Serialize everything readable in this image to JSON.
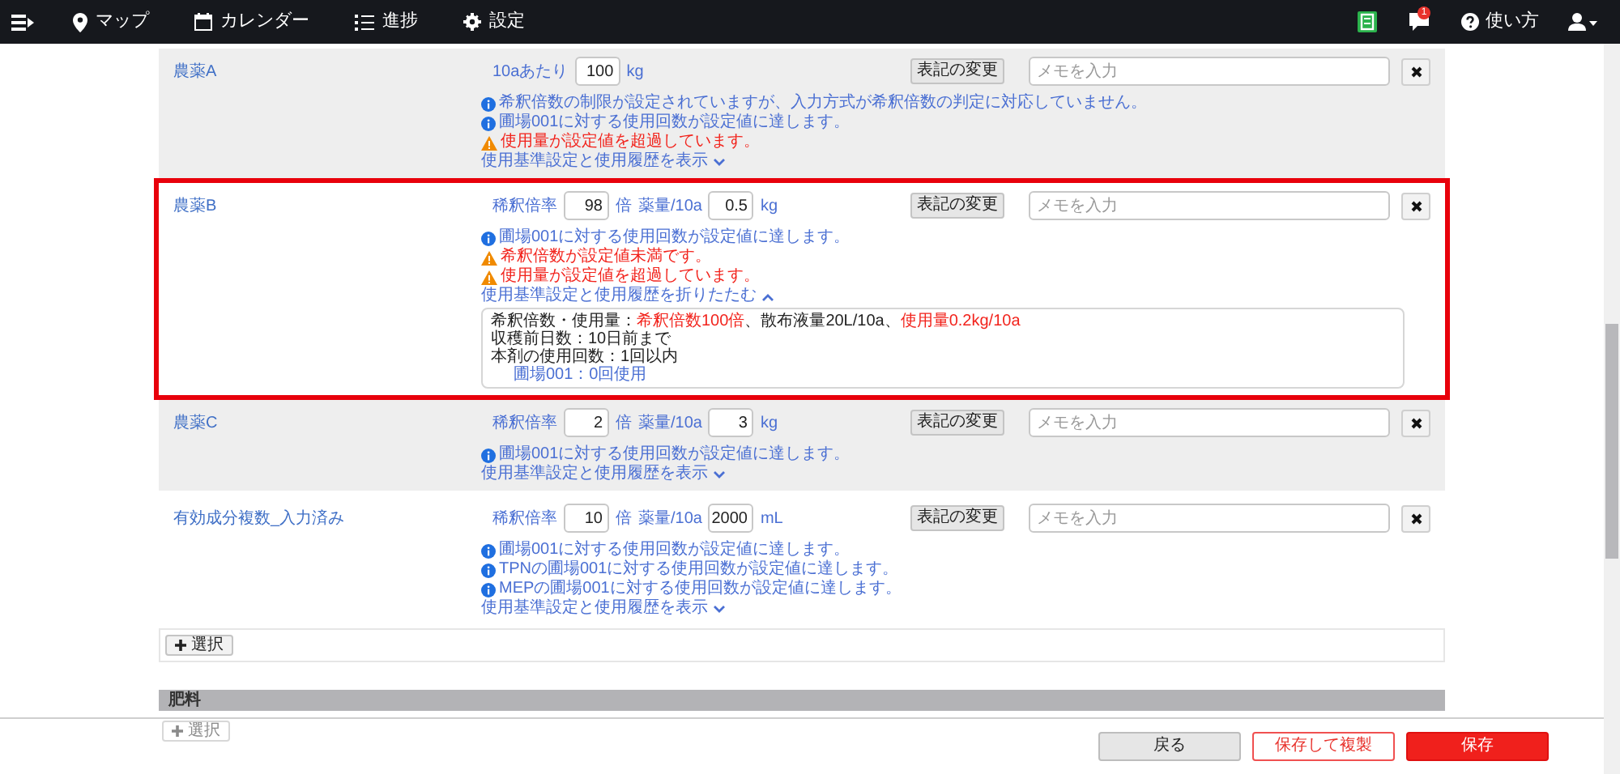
{
  "nav": {
    "items": [
      {
        "label": "マップ"
      },
      {
        "label": "カレンダー"
      },
      {
        "label": "進捗"
      },
      {
        "label": "設定"
      }
    ],
    "notification_count": "1",
    "help": "使い方"
  },
  "rows": [
    {
      "name": "農薬A",
      "highlighted": false,
      "inputs": [
        {
          "label": "10aあたり",
          "value": "100",
          "unit": "kg"
        }
      ],
      "change_button": "表記の変更",
      "memo_placeholder": "メモを入力",
      "messages": [
        {
          "kind": "info",
          "text": "希釈倍数の制限が設定されていますが、入力方式が希釈倍数の判定に対応していません。"
        },
        {
          "kind": "info",
          "text": "圃場001に対する使用回数が設定値に達します。"
        },
        {
          "kind": "warning",
          "text": "使用量が設定値を超過しています。"
        }
      ],
      "toggle": {
        "label": "使用基準設定と使用履歴を表示",
        "expanded": false
      }
    },
    {
      "name": "農薬B",
      "highlighted": true,
      "inputs": [
        {
          "label": "稀釈倍率",
          "value": "98",
          "unit": "倍"
        },
        {
          "label": "薬量/10a",
          "value": "0.5",
          "unit": "kg"
        }
      ],
      "change_button": "表記の変更",
      "memo_placeholder": "メモを入力",
      "messages": [
        {
          "kind": "info",
          "text": "圃場001に対する使用回数が設定値に達します。"
        },
        {
          "kind": "warning",
          "text": "希釈倍数が設定値未満です。"
        },
        {
          "kind": "warning",
          "text": "使用量が設定値を超過しています。"
        }
      ],
      "toggle": {
        "label": "使用基準設定と使用履歴を折りたたむ",
        "expanded": true
      },
      "details": [
        {
          "kind": "main",
          "segments": [
            {
              "text": "希釈倍数・使用量：",
              "alert": false
            },
            {
              "text": "希釈倍数100倍",
              "alert": true
            },
            {
              "text": "、散布液量20L/10a、",
              "alert": false
            },
            {
              "text": "使用量0.2kg/10a",
              "alert": true
            }
          ]
        },
        {
          "kind": "main",
          "segments": [
            {
              "text": "収穫前日数：10日前まで",
              "alert": false
            }
          ]
        },
        {
          "kind": "main",
          "segments": [
            {
              "text": "本剤の使用回数：1回以内",
              "alert": false
            }
          ]
        },
        {
          "kind": "sub",
          "segments": [
            {
              "text": "圃場001：0回使用",
              "alert": false
            }
          ]
        }
      ]
    },
    {
      "name": "農薬C",
      "highlighted": false,
      "inputs": [
        {
          "label": "稀釈倍率",
          "value": "2",
          "unit": "倍"
        },
        {
          "label": "薬量/10a",
          "value": "3",
          "unit": "kg"
        }
      ],
      "change_button": "表記の変更",
      "memo_placeholder": "メモを入力",
      "messages": [
        {
          "kind": "info",
          "text": "圃場001に対する使用回数が設定値に達します。"
        }
      ],
      "toggle": {
        "label": "使用基準設定と使用履歴を表示",
        "expanded": false
      }
    },
    {
      "name": "有効成分複数_入力済み",
      "highlighted": false,
      "inputs": [
        {
          "label": "稀釈倍率",
          "value": "10",
          "unit": "倍"
        },
        {
          "label": "薬量/10a",
          "value": "2000",
          "unit": "mL"
        }
      ],
      "change_button": "表記の変更",
      "memo_placeholder": "メモを入力",
      "messages": [
        {
          "kind": "info",
          "text": "圃場001に対する使用回数が設定値に達します。"
        },
        {
          "kind": "info",
          "text": "TPNの圃場001に対する使用回数が設定値に達します。"
        },
        {
          "kind": "info",
          "text": "MEPの圃場001に対する使用回数が設定値に達します。"
        }
      ],
      "toggle": {
        "label": "使用基準設定と使用履歴を表示",
        "expanded": false
      }
    }
  ],
  "select_button": {
    "label": "選択",
    "disabled": false
  },
  "fertilizer": {
    "title": "肥料",
    "select_button": {
      "label": "選択",
      "disabled": true
    }
  },
  "footer_buttons": [
    {
      "label": "戻る",
      "kind": "secondary"
    },
    {
      "label": "保存して複製",
      "kind": "outline"
    },
    {
      "label": "保存",
      "kind": "primary"
    }
  ]
}
